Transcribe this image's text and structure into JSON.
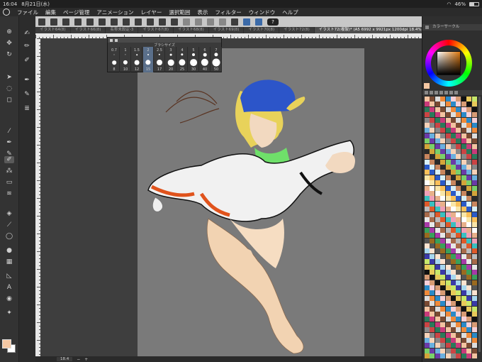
{
  "status": {
    "time": "16:04",
    "date": "8月21日(水)",
    "battery": "46%",
    "battery_level": 0.46
  },
  "menu": [
    "ファイル",
    "編集",
    "ページ管理",
    "アニメーション",
    "レイヤー",
    "選択範囲",
    "表示",
    "フィルター",
    "ウィンドウ",
    "ヘルプ"
  ],
  "tabs": [
    {
      "label": "イラスト64(8)",
      "active": false
    },
    {
      "label": "イラスト66(8)",
      "active": false
    },
    {
      "label": "名称未設定-3",
      "active": false
    },
    {
      "label": "イラスト67(8)",
      "active": false
    },
    {
      "label": "イラスト68(8)",
      "active": false
    },
    {
      "label": "イラスト69(8)",
      "active": false
    },
    {
      "label": "イラスト70(8)",
      "active": false
    },
    {
      "label": "イラスト72(8)",
      "active": false
    },
    {
      "label": "イラスト72(複製)* (A5 6992 x 9921px 1200dpi 18.4%)",
      "active": true
    }
  ],
  "brush_popup": {
    "title": "ブラシサイズ",
    "top_row": [
      "0.7",
      "1",
      "1.5",
      "2",
      "2.5",
      "3",
      "4",
      "5",
      "6",
      "7"
    ],
    "bottom_row": [
      "8",
      "10",
      "12",
      "15",
      "17",
      "20",
      "25",
      "30",
      "40",
      "50"
    ],
    "selected_index": 3
  },
  "zoom": "18.4",
  "help_label": "?",
  "panel": {
    "color_title": "カラーサークル"
  },
  "colors": {
    "main": "#f4c7a3",
    "sub": "#ffffff",
    "accent": "#3b6aa8"
  }
}
